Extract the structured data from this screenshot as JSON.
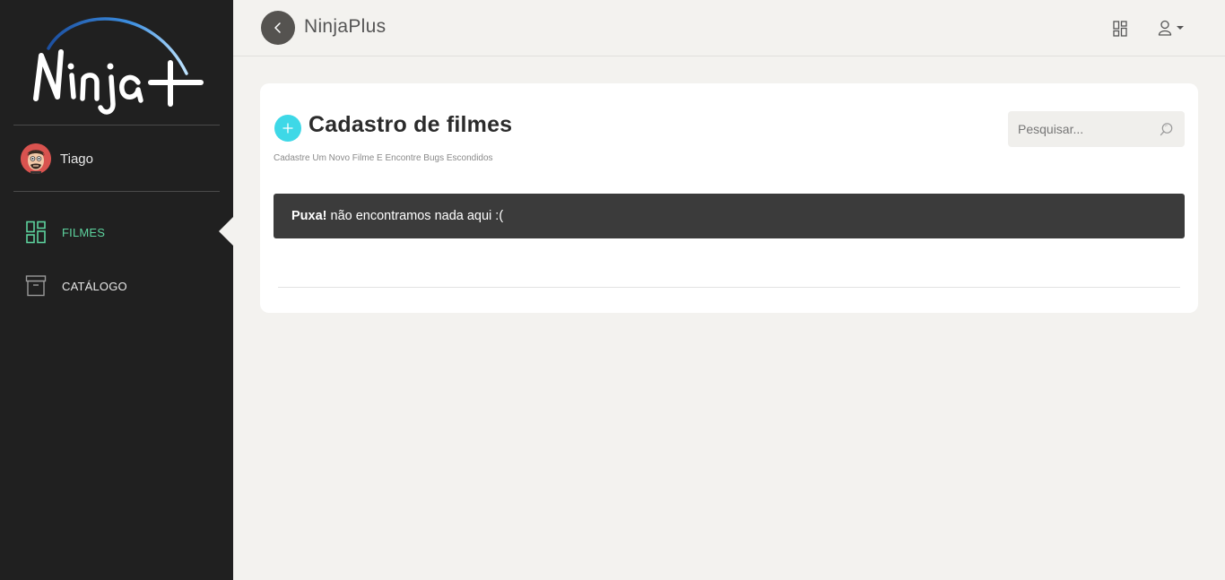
{
  "brand": {
    "logo_text": "Ninja+"
  },
  "user": {
    "name": "Tiago"
  },
  "sidebar": {
    "items": [
      {
        "label": "FILMES",
        "icon": "dashboard-icon",
        "active": true
      },
      {
        "label": "CATÁLOGO",
        "icon": "archive-icon",
        "active": false
      }
    ]
  },
  "header": {
    "title": "NinjaPlus"
  },
  "main": {
    "title": "Cadastro de filmes",
    "subtitle": "Cadastre Um Novo Filme E Encontre Bugs Escondidos",
    "search": {
      "placeholder": "Pesquisar..."
    },
    "alert": {
      "strong": "Puxa!",
      "text": "não encontramos nada aqui :("
    }
  },
  "colors": {
    "sidebar_bg": "#202020",
    "accent_green": "#5dd39e",
    "accent_cyan": "#3ed8e7",
    "alert_bg": "#3b3b3b",
    "page_bg": "#f3f2ef"
  }
}
